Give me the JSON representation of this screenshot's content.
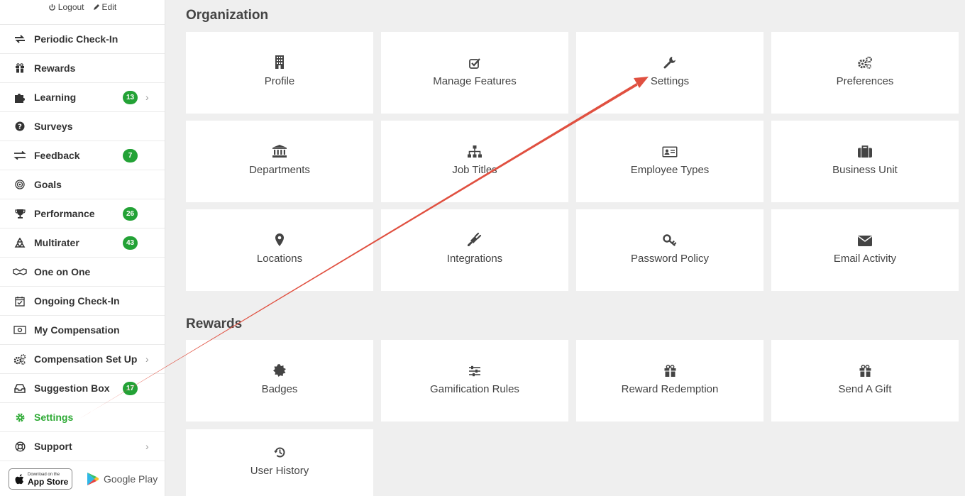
{
  "sidebar": {
    "top": {
      "logout": "Logout",
      "edit": "Edit"
    },
    "items": [
      {
        "label": "Periodic Check-In",
        "icon": "refresh-icon"
      },
      {
        "label": "Rewards",
        "icon": "gift-icon"
      },
      {
        "label": "Learning",
        "icon": "puzzle-icon",
        "badge": "13"
      },
      {
        "label": "Surveys",
        "icon": "question-icon"
      },
      {
        "label": "Feedback",
        "icon": "exchange-icon",
        "badge": "7"
      },
      {
        "label": "Goals",
        "icon": "target-icon"
      },
      {
        "label": "Performance",
        "icon": "trophy-icon",
        "badge": "26"
      },
      {
        "label": "Multirater",
        "icon": "recycle-icon",
        "badge": "43"
      },
      {
        "label": "One on One",
        "icon": "handshake-icon"
      },
      {
        "label": "Ongoing Check-In",
        "icon": "calendar-check-icon"
      },
      {
        "label": "My Compensation",
        "icon": "money-icon"
      },
      {
        "label": "Compensation Set Up",
        "icon": "cogs-icon"
      },
      {
        "label": "Suggestion Box",
        "icon": "inbox-icon",
        "badge": "17"
      },
      {
        "label": "Settings",
        "icon": "gear-icon"
      },
      {
        "label": "Support",
        "icon": "lifebuoy-icon"
      }
    ],
    "stores": {
      "appstore_small": "Download on the",
      "appstore_big": "App Store",
      "googleplay": "Google Play"
    }
  },
  "main": {
    "organization": {
      "title": "Organization",
      "tiles": [
        {
          "label": "Profile",
          "icon": "building-icon"
        },
        {
          "label": "Manage Features",
          "icon": "checkbox-icon"
        },
        {
          "label": "Settings",
          "icon": "wrench-icon"
        },
        {
          "label": "Preferences",
          "icon": "cogs-icon"
        },
        {
          "label": "Departments",
          "icon": "institution-icon"
        },
        {
          "label": "Job Titles",
          "icon": "sitemap-icon"
        },
        {
          "label": "Employee Types",
          "icon": "id-card-icon"
        },
        {
          "label": "Business Unit",
          "icon": "briefcase-icon"
        },
        {
          "label": "Locations",
          "icon": "map-marker-icon"
        },
        {
          "label": "Integrations",
          "icon": "plug-icon"
        },
        {
          "label": "Password Policy",
          "icon": "key-icon"
        },
        {
          "label": "Email Activity",
          "icon": "envelope-icon"
        }
      ]
    },
    "rewards": {
      "title": "Rewards",
      "tiles": [
        {
          "label": "Badges",
          "icon": "certificate-icon"
        },
        {
          "label": "Gamification Rules",
          "icon": "sliders-icon"
        },
        {
          "label": "Reward Redemption",
          "icon": "gift-icon"
        },
        {
          "label": "Send A Gift",
          "icon": "gift-icon"
        },
        {
          "label": "User History",
          "icon": "history-icon"
        }
      ]
    }
  },
  "colors": {
    "active": "#2eaa35",
    "badge": "#23a236",
    "arrow": "#e05040"
  }
}
